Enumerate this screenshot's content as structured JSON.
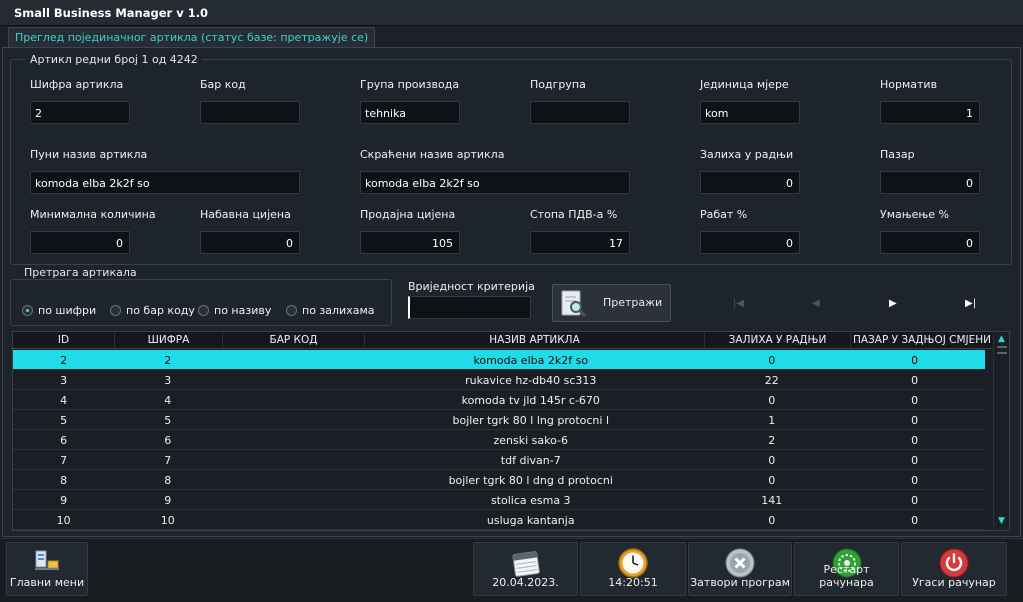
{
  "app": {
    "title": "Small Business Manager  v 1.0"
  },
  "tab": {
    "label": "Преглед појединачног  артикла   (статус базе: претражује се)"
  },
  "article": {
    "legend": "Артикл  редни  број  1  од  4242",
    "fields": {
      "sifra": {
        "label": "Шифра артикла",
        "value": "2"
      },
      "barkod": {
        "label": "Бар код",
        "value": ""
      },
      "grupa": {
        "label": "Група производа",
        "value": "tehnika"
      },
      "podgrupa": {
        "label": "Подгрупа",
        "value": ""
      },
      "jedinica": {
        "label": "Јединица мјере",
        "value": "kom"
      },
      "normativ": {
        "label": "Норматив",
        "value": "1"
      },
      "puni_naziv": {
        "label": "Пуни назив артикла",
        "value": "komoda elba 2k2f so"
      },
      "skraceni_naziv": {
        "label": "Скраћени назив артикла",
        "value": "komoda elba 2k2f so"
      },
      "zaliha": {
        "label": "Залиха у радњи",
        "value": "0"
      },
      "pazar": {
        "label": "Пазар",
        "value": "0"
      },
      "min_kolicina": {
        "label": "Минимална количина",
        "value": "0"
      },
      "nabavna": {
        "label": "Набавна цијена",
        "value": "0"
      },
      "prodajna": {
        "label": "Продајна цијена",
        "value": "105"
      },
      "pdv": {
        "label": "Стопа ПДВ-а  %",
        "value": "17"
      },
      "rabat": {
        "label": "Рабат  %",
        "value": "0"
      },
      "umanjenje": {
        "label": "Умањење  %",
        "value": "0"
      }
    }
  },
  "search": {
    "legend": "Претрага артикала",
    "criteria_label": "Вриједност критерија",
    "criteria_value": "",
    "button_label": "Претражи",
    "options": [
      {
        "label": "по шифри",
        "selected": true
      },
      {
        "label": "по бар коду",
        "selected": false
      },
      {
        "label": "по називу",
        "selected": false
      },
      {
        "label": "по залихама",
        "selected": false
      }
    ]
  },
  "grid": {
    "columns": [
      "ID",
      "ШИФРА",
      "БАР КОД",
      "НАЗИВ АРТИКЛА",
      "ЗАЛИХА У РАДЊИ",
      "ПАЗАР У ЗАДЊОЈ СМЈЕНИ"
    ],
    "rows": [
      [
        "2",
        "2",
        "",
        "komoda elba 2k2f so",
        "0",
        "0"
      ],
      [
        "3",
        "3",
        "",
        "rukavice hz-db40 sc313",
        "22",
        "0"
      ],
      [
        "4",
        "4",
        "",
        "komoda tv jld 145r c-670",
        "0",
        "0"
      ],
      [
        "5",
        "5",
        "",
        "bojler tgrk 80 l lng protocni l",
        "1",
        "0"
      ],
      [
        "6",
        "6",
        "",
        "zenski sako-6",
        "2",
        "0"
      ],
      [
        "7",
        "7",
        "",
        "tdf divan-7",
        "0",
        "0"
      ],
      [
        "8",
        "8",
        "",
        "bojler tgrk 80 l dng d protocni",
        "0",
        "0"
      ],
      [
        "9",
        "9",
        "",
        "stolica esma 3",
        "141",
        "0"
      ],
      [
        "10",
        "10",
        "",
        "usluga kantanja",
        "0",
        "0"
      ]
    ],
    "selected_row": 0
  },
  "bottom": {
    "main_menu": "Главни мени",
    "date": "20.04.2023.",
    "time": "14:20:51",
    "close": "Затвори програм",
    "restart": "Рестарт рачунара",
    "shutdown": "Угаси рачунар"
  },
  "colors": {
    "accent": "#1fdce8",
    "tab_text": "#3ecfcf",
    "background": "#1c2128"
  }
}
